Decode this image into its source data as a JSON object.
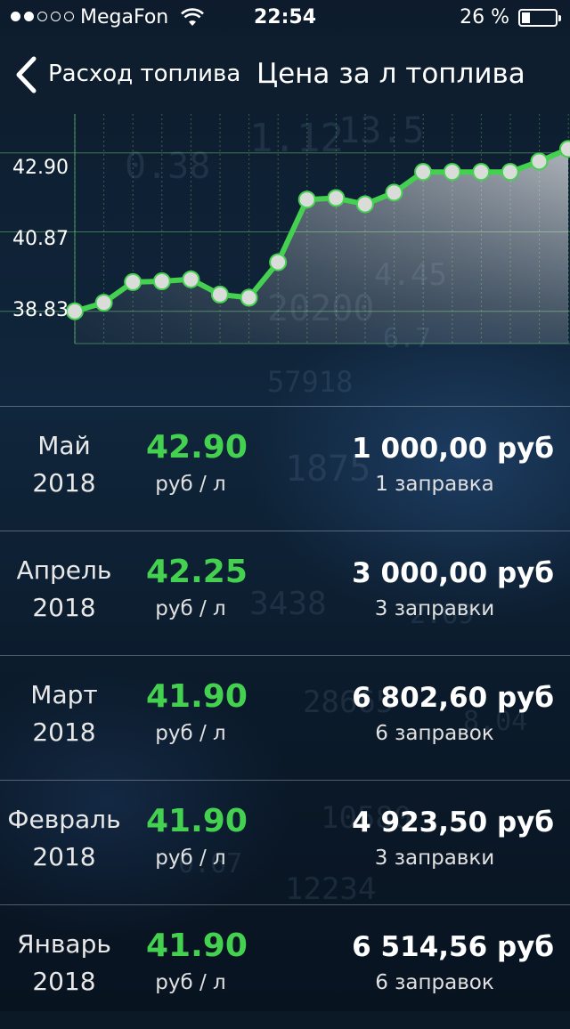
{
  "status_bar": {
    "carrier": "MegaFon",
    "time": "22:54",
    "battery": "26 %",
    "battery_level": 0.26,
    "signal_bars_filled": 2,
    "signal_bars_total": 5
  },
  "nav": {
    "back_label": "Расход топлива",
    "title": "Цена за л топлива"
  },
  "colors": {
    "accent_green": "#44d150",
    "navbar_bg": "#0f1e2e"
  },
  "chart_data": {
    "type": "line",
    "title": "",
    "xlabel": "",
    "ylabel": "",
    "y_tick_labels": [
      "42.90",
      "40.87",
      "38.83"
    ],
    "y_ticks": [
      42.9,
      40.87,
      38.83
    ],
    "ylim": [
      38.0,
      43.9
    ],
    "grid": true,
    "series": [
      {
        "values": [
          38.83,
          39.05,
          39.58,
          39.6,
          39.65,
          39.26,
          39.18,
          40.09,
          41.7,
          41.74,
          41.58,
          41.88,
          42.41,
          42.41,
          42.41,
          42.41,
          42.68,
          43.0
        ]
      }
    ]
  },
  "list": [
    {
      "month": "Май",
      "year": "2018",
      "price": "42.90",
      "unit": "руб / л",
      "total": "1 000,00 руб",
      "count": "1 заправка"
    },
    {
      "month": "Апрель",
      "year": "2018",
      "price": "42.25",
      "unit": "руб / л",
      "total": "3 000,00 руб",
      "count": "3 заправки"
    },
    {
      "month": "Март",
      "year": "2018",
      "price": "41.90",
      "unit": "руб / л",
      "total": "6 802,60 руб",
      "count": "6 заправок"
    },
    {
      "month": "Февраль",
      "year": "2018",
      "price": "41.90",
      "unit": "руб / л",
      "total": "4 923,50 руб",
      "count": "3 заправки"
    },
    {
      "month": "Январь",
      "year": "2018",
      "price": "41.90",
      "unit": "руб / л",
      "total": "6 514,56 руб",
      "count": "6 заправок"
    }
  ]
}
